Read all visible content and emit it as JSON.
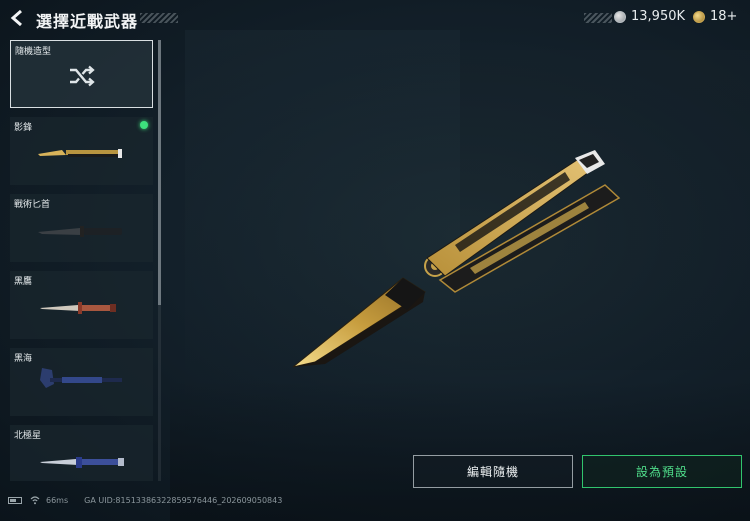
{
  "header": {
    "title": "選擇近戰武器",
    "back_icon": "chevron-left-icon"
  },
  "currency": {
    "cod_points": "13,950K",
    "points_icon": "silver-coin-icon",
    "credits": "18+",
    "credits_icon": "gold-coin-icon"
  },
  "sidebar": {
    "random": {
      "label": "隨機造型",
      "icon": "shuffle-icon"
    },
    "items": [
      {
        "label": "影鋒",
        "equipped": true
      },
      {
        "label": "戰術匕首",
        "equipped": false
      },
      {
        "label": "黑鷹",
        "equipped": false
      },
      {
        "label": "黑海",
        "equipped": false
      },
      {
        "label": "北極星",
        "equipped": false
      }
    ]
  },
  "actions": {
    "edit_random": "編輯隨機",
    "set_default": "設為預設"
  },
  "status": {
    "ping": "66ms",
    "uid": "GA UID:8151338632285957​6446_202609050843"
  },
  "colors": {
    "accent_green": "#3de07d",
    "gold": "#c9a54a"
  }
}
